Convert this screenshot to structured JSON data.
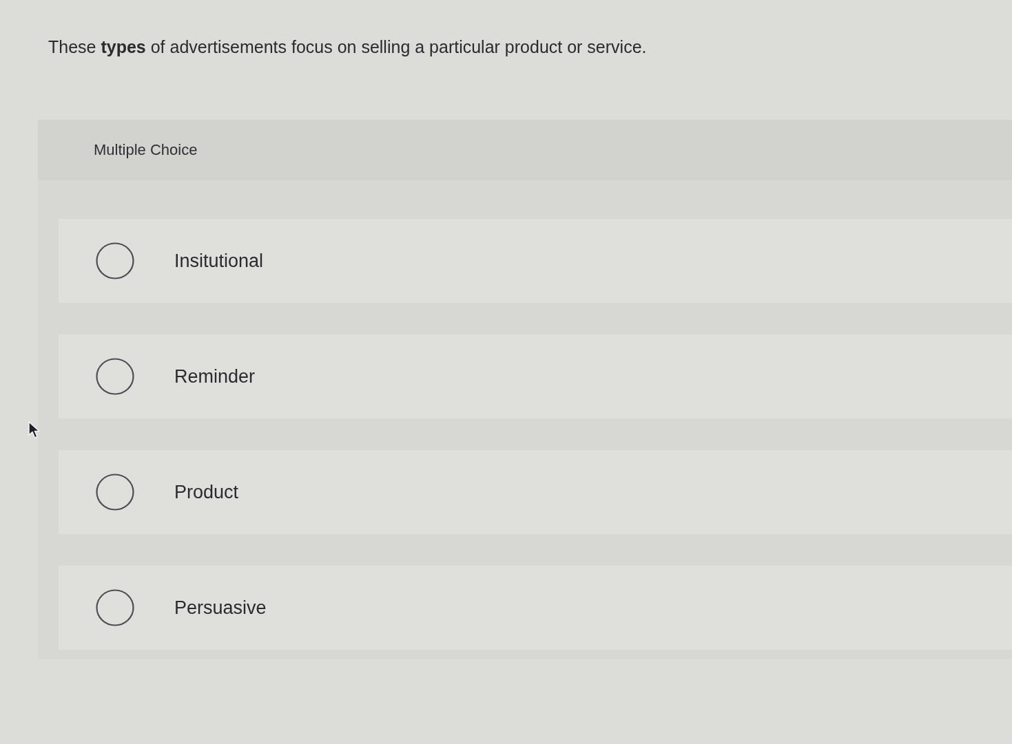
{
  "question": {
    "text": "These **types** of advertisements focus on selling a particular product or service."
  },
  "multiple_choice": {
    "label": "Multiple Choice",
    "options": [
      {
        "label": "Insitutional",
        "selected": false
      },
      {
        "label": "Reminder",
        "selected": false
      },
      {
        "label": "Product",
        "selected": false
      },
      {
        "label": "Persuasive",
        "selected": false
      }
    ]
  }
}
